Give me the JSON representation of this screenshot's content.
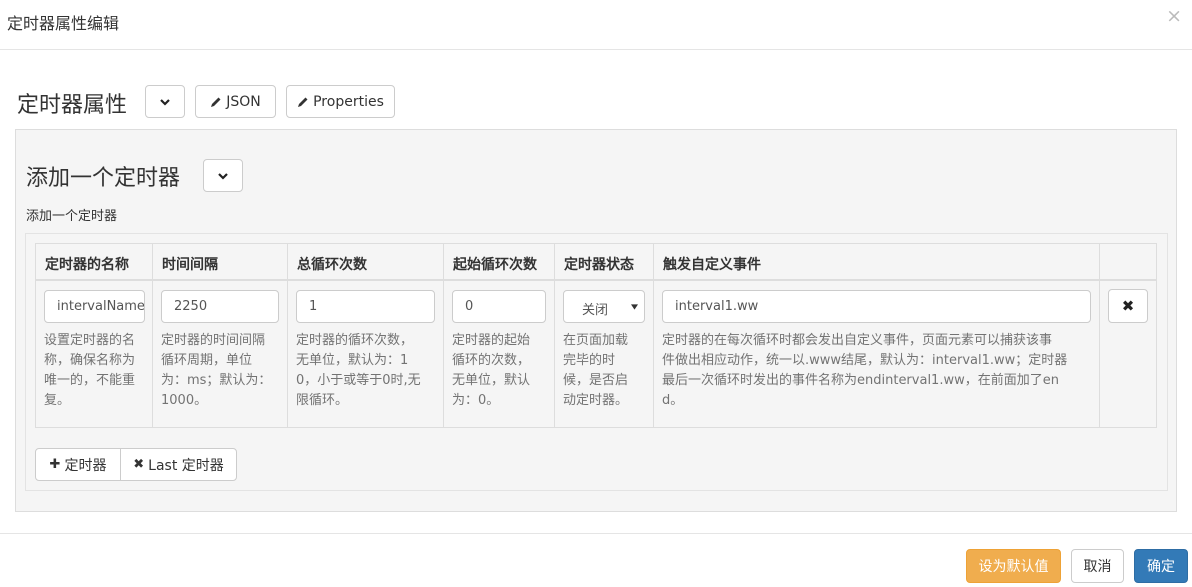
{
  "modal": {
    "title": "定时器属性编辑",
    "close": "×"
  },
  "header": {
    "title": "定时器属性",
    "json_label": "JSON",
    "properties_label": "Properties"
  },
  "section": {
    "title": "添加一个定时器",
    "subtitle": "添加一个定时器"
  },
  "table": {
    "columns": [
      "定时器的名称",
      "时间间隔",
      "总循环次数",
      "起始循环次数",
      "定时器状态",
      "触发自定义事件"
    ],
    "row": {
      "name_value": "intervalName",
      "interval_value": "2250",
      "total_loops_value": "1",
      "start_loop_value": "0",
      "status_value": "关闭",
      "event_value": "interval1.ww",
      "help": {
        "name": [
          "设置定时器的名",
          "称，确保名称为",
          "唯一的，不能重",
          "复。"
        ],
        "interval": [
          "定时器的时间间隔",
          "循环周期，单位",
          "为：ms；默认为：",
          "1000。"
        ],
        "total_loops": [
          "定时器的循环次数，",
          "无单位，默认为：1",
          "0，小于或等于0时,无",
          "限循环。"
        ],
        "start_loop": [
          "定时器的起始",
          "循环的次数，",
          "无单位，默认",
          "为：0。"
        ],
        "status": [
          "在页面加载",
          "完毕的时",
          "候，是否启",
          "动定时器。"
        ],
        "event": [
          "定时器的在每次循环时都会发出自定义事件，页面元素可以捕获该事",
          "件做出相应动作，统一以.www结尾，默认为：interval1.ww；定时器",
          "最后一次循环时发出的事件名称为endinterval1.ww，在前面加了en",
          "d。"
        ]
      },
      "remove_symbol": "✖"
    }
  },
  "actions": {
    "add_label": "定时器",
    "add_symbol": "✚",
    "remove_last_label": "Last 定时器",
    "remove_symbol": "✖"
  },
  "footer": {
    "default_label": "设为默认值",
    "cancel_label": "取消",
    "ok_label": "确定"
  },
  "colors": {
    "primary": "#337ab7",
    "warning": "#f0ad4e",
    "panel_bg": "#f5f5f5",
    "border": "#dddddd"
  }
}
